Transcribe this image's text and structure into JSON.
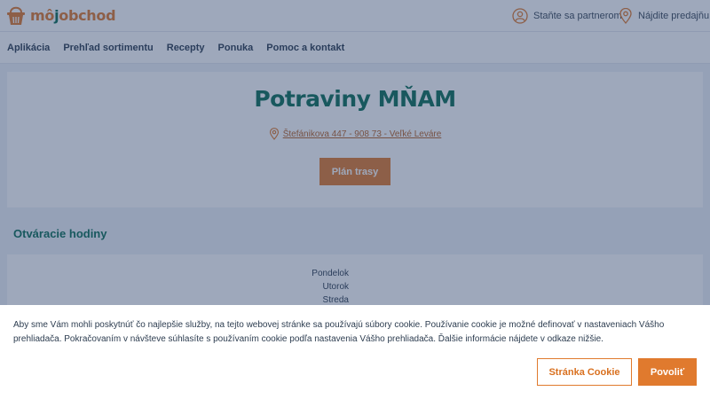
{
  "brand": {
    "logo_part1": "mô",
    "logo_part2": "j",
    "logo_part3": "obchod",
    "colors": {
      "orange": "#e07a2e",
      "green": "#0b6e57",
      "link": "#b8642a"
    }
  },
  "header": {
    "partner_link": "Staňte sa partnerom",
    "partner_icon": "person-icon",
    "store_link": "Nájdite predajňu",
    "store_icon": "location-pin-icon"
  },
  "nav": {
    "items": [
      {
        "label": "Aplikácia"
      },
      {
        "label": "Prehľad sortimentu"
      },
      {
        "label": "Recepty"
      },
      {
        "label": "Ponuka"
      },
      {
        "label": "Pomoc a kontakt"
      }
    ]
  },
  "store": {
    "name": "Potraviny MŇAM",
    "address": "Štefánikova 447 - 908 73 - Veľké Leváre",
    "address_icon": "location-pin-icon",
    "route_button": "Plán trasy"
  },
  "hours": {
    "title": "Otváracie hodiny",
    "days": [
      "Pondelok",
      "Utorok",
      "Streda"
    ]
  },
  "cookie_banner": {
    "text": "Aby sme Vám mohli poskytnúť čo najlepšie služby, na tejto webovej stránke sa používajú súbory cookie. Používanie cookie je možné definovať v nastaveniach Vášho prehliadača. Pokračovaním v návšteve súhlasíte s používaním cookie podľa nastavenia Vášho prehliadača. Ďalšie informácie nájdete v odkaze nižšie.",
    "cookie_page_button": "Stránka Cookie",
    "allow_button": "Povoliť"
  }
}
